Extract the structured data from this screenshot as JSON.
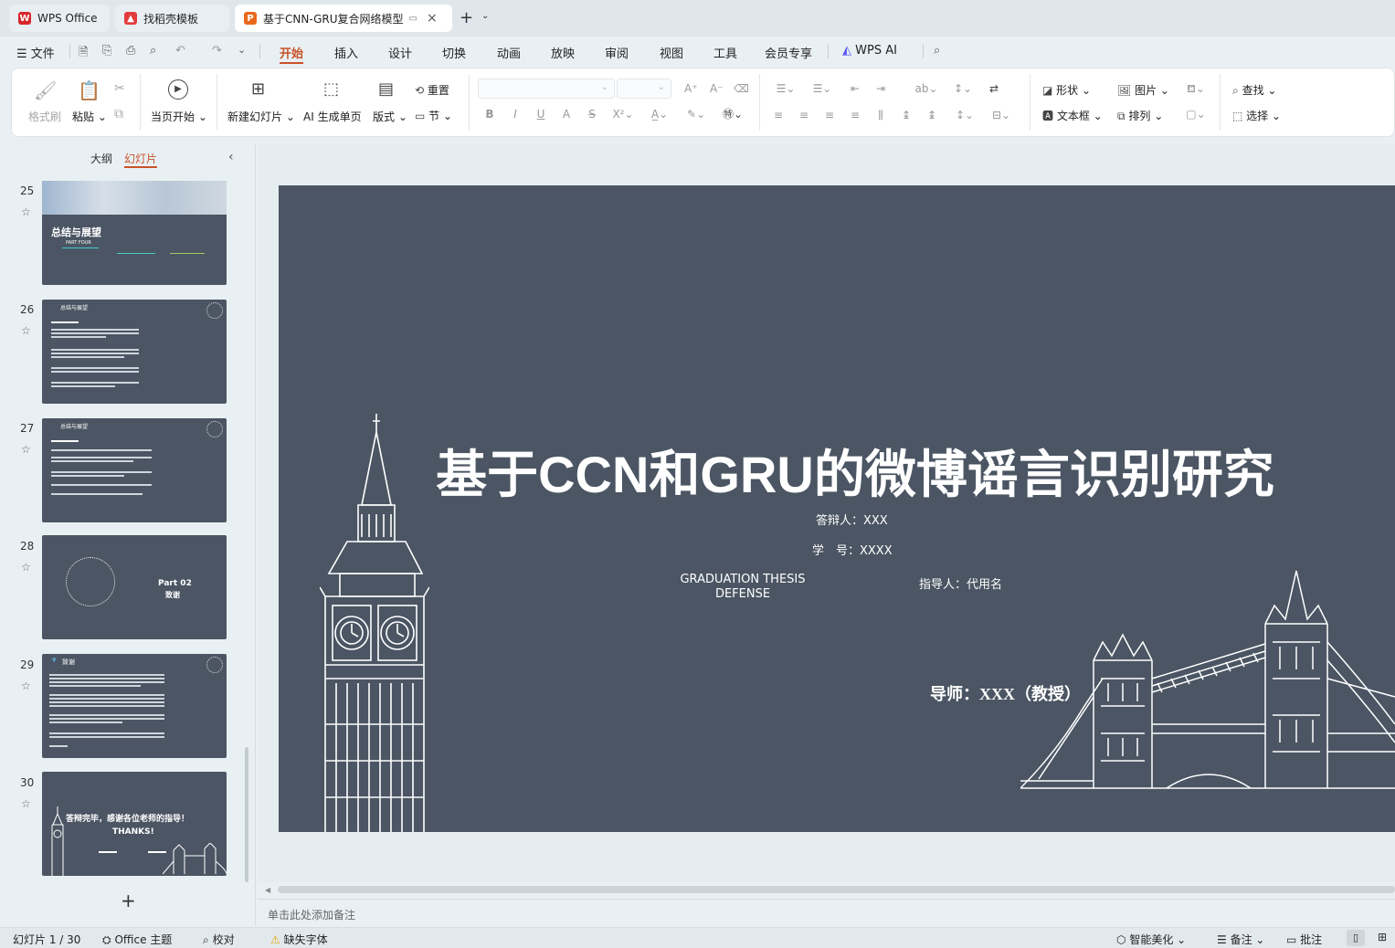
{
  "tabs": [
    {
      "label": "WPS Office",
      "icon": "wps-logo-icon"
    },
    {
      "label": "找稻壳模板",
      "icon": "docer-icon"
    },
    {
      "label": "基于CNN-GRU复合网络模型",
      "icon": "presentation-icon"
    }
  ],
  "menu": {
    "file": "文件",
    "items": [
      "开始",
      "插入",
      "设计",
      "切换",
      "动画",
      "放映",
      "审阅",
      "视图",
      "工具",
      "会员专享"
    ],
    "active": "开始",
    "wps_ai": "WPS AI"
  },
  "ribbon": {
    "format_painter": "格式刷",
    "paste": "粘贴",
    "play_from_current": "当页开始",
    "new_slide": "新建幻灯片",
    "ai_page": "AI 生成单页",
    "layout": "版式",
    "reset": "重置",
    "section": "节",
    "shape": "形状",
    "picture": "图片",
    "textbox": "文本框",
    "arrange": "排列",
    "find": "查找",
    "select": "选择"
  },
  "panel": {
    "outline_tab": "大纲",
    "slides_tab": "幻灯片",
    "add": "+"
  },
  "thumbs": [
    {
      "num": "25",
      "title": "总结与展望",
      "sub": "PART FOUR"
    },
    {
      "num": "26",
      "title": "总结与展望"
    },
    {
      "num": "27",
      "title": "总结与展望"
    },
    {
      "num": "28",
      "title": "Part 02",
      "sub": "致谢"
    },
    {
      "num": "29",
      "title": "致谢"
    },
    {
      "num": "30",
      "title": "答辩完毕，感谢各位老师的指导！",
      "sub": "THANKS!"
    }
  ],
  "slide": {
    "title": "基于CCN和GRU的微博谣言识别研究",
    "presenter": "答辩人：XXX",
    "student_id": "学　号：XXXX",
    "en_line1": "GRADUATION THESIS",
    "en_line2": "DEFENSE",
    "advisor": "指导人：代用名",
    "mentor": "导师：XXX（教授）"
  },
  "notes_placeholder": "单击此处添加备注",
  "status": {
    "slide_counter": "幻灯片 1 / 30",
    "theme": "Office 主题",
    "proof": "校对",
    "missing_font": "缺失字体",
    "beautify": "智能美化",
    "notes": "备注",
    "comments": "批注"
  },
  "colors": {
    "slide_bg": "#4b5563",
    "accent": "#c8532a",
    "tab_active_bg": "#ffffff"
  }
}
